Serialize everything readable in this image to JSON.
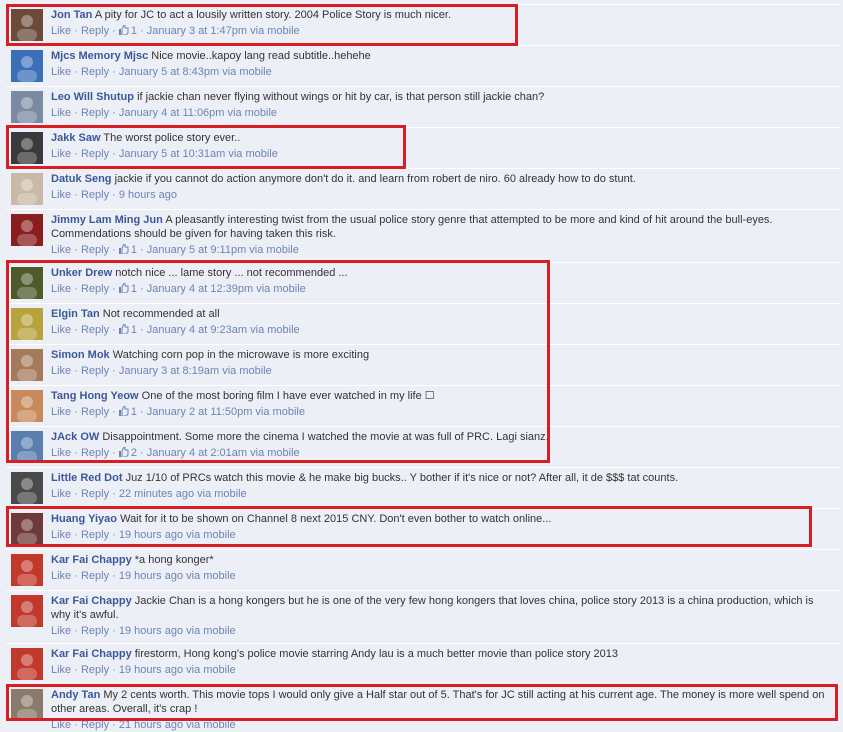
{
  "comments": [
    {
      "author": "Jon Tan",
      "text": "A pity for JC to act a lousily written story. 2004 Police Story is much nicer.",
      "like": "Like",
      "reply": "Reply",
      "likes": "1",
      "time": "January 3 at 1:47pm via mobile",
      "avatar_color": "#6b4a3a"
    },
    {
      "author": "Mjcs Memory Mjsc",
      "text": "Nice movie..kapoy lang read subtitle..hehehe",
      "like": "Like",
      "reply": "Reply",
      "likes": "",
      "time": "January 5 at 8:43pm via mobile",
      "avatar_color": "#3b6fb8"
    },
    {
      "author": "Leo Will Shutup",
      "text": "if jackie chan never flying without wings or hit by car, is that person still jackie chan?",
      "like": "Like",
      "reply": "Reply",
      "likes": "",
      "time": "January 4 at 11:06pm via mobile",
      "avatar_color": "#7a8aa0"
    },
    {
      "author": "Jakk Saw",
      "text": "The worst police story ever..",
      "like": "Like",
      "reply": "Reply",
      "likes": "",
      "time": "January 5 at 10:31am via mobile",
      "avatar_color": "#3a3a3a"
    },
    {
      "author": "Datuk Seng",
      "text": "jackie if you cannot do action anymore don't do it. and learn from robert de niro. 60 already how to do stunt.",
      "like": "Like",
      "reply": "Reply",
      "likes": "",
      "time": "9 hours ago",
      "avatar_color": "#c9b9a6"
    },
    {
      "author": "Jimmy Lam Ming Jun",
      "text": "A pleasantly interesting twist from the usual police story genre that attempted to be more and kind of hit around the bull-eyes. Commendations should be given for having taken this risk.",
      "like": "Like",
      "reply": "Reply",
      "likes": "1",
      "time": "January 5 at 9:11pm via mobile",
      "avatar_color": "#8a1e1e"
    },
    {
      "author": "Unker Drew",
      "text": "notch nice ... lame story ... not recommended ...",
      "like": "Like",
      "reply": "Reply",
      "likes": "1",
      "time": "January 4 at 12:39pm via mobile",
      "avatar_color": "#4d5a2a"
    },
    {
      "author": "Elgin Tan",
      "text": "Not recommended at all",
      "like": "Like",
      "reply": "Reply",
      "likes": "1",
      "time": "January 4 at 9:23am via mobile",
      "avatar_color": "#b7a23c"
    },
    {
      "author": "Simon Mok",
      "text": "Watching corn pop in the microwave is more exciting",
      "like": "Like",
      "reply": "Reply",
      "likes": "",
      "time": "January 3 at 8:19am via mobile",
      "avatar_color": "#a57a5a"
    },
    {
      "author": "Tang Hong Yeow",
      "text": "One of the most boring film I have ever watched in my life ☐",
      "like": "Like",
      "reply": "Reply",
      "likes": "1",
      "time": "January 2 at 11:50pm via mobile",
      "avatar_color": "#c88a5a"
    },
    {
      "author": "JAck OW",
      "text": "Disappointment. Some more the cinema I watched the movie at was full of PRC. Lagi sianz.",
      "like": "Like",
      "reply": "Reply",
      "likes": "2",
      "time": "January 4 at 2:01am via mobile",
      "avatar_color": "#5a7fae"
    },
    {
      "author": "Little Red Dot",
      "text": "Juz 1/10 of PRCs watch this movie & he make big bucks.. Y bother if it's nice or not? After all, it de $$$ tat counts.",
      "like": "Like",
      "reply": "Reply",
      "likes": "",
      "time": "22 minutes ago via mobile",
      "avatar_color": "#4a4a4a"
    },
    {
      "author": "Huang Yiyao",
      "text": "Wait for it to be shown on Channel 8 next 2015 CNY. Don't even bother to watch online...",
      "like": "Like",
      "reply": "Reply",
      "likes": "",
      "time": "19 hours ago via mobile",
      "avatar_color": "#6e3a3a"
    },
    {
      "author": "Kar Fai Chappy",
      "text": "*a hong konger*",
      "like": "Like",
      "reply": "Reply",
      "likes": "",
      "time": "19 hours ago via mobile",
      "avatar_color": "#c0392b"
    },
    {
      "author": "Kar Fai Chappy",
      "text": "Jackie Chan is a hong kongers but he is one of the very few hong kongers that loves china, police story 2013 is a china production, which is why it's awful.",
      "like": "Like",
      "reply": "Reply",
      "likes": "",
      "time": "19 hours ago via mobile",
      "avatar_color": "#c0392b"
    },
    {
      "author": "Kar Fai Chappy",
      "text": "firestorm, Hong kong's police movie starring Andy lau is a much better movie than police story 2013",
      "like": "Like",
      "reply": "Reply",
      "likes": "",
      "time": "19 hours ago via mobile",
      "avatar_color": "#c0392b"
    },
    {
      "author": "Andy Tan",
      "text": "My 2 cents worth. This movie tops I would only give a Half star out of 5. That's for JC still acting at his current age. The money is more well spend on other areas. Overall, it's crap !",
      "like": "Like",
      "reply": "Reply",
      "likes": "",
      "time": "21 hours ago via mobile",
      "avatar_color": "#8a7a6a"
    }
  ],
  "colors": {
    "highlight": "#d71e25",
    "author": "#3b5998",
    "link": "#6d84b4",
    "background": "#eceff5"
  },
  "icons": {
    "like_count": "thumbs-up-icon"
  }
}
